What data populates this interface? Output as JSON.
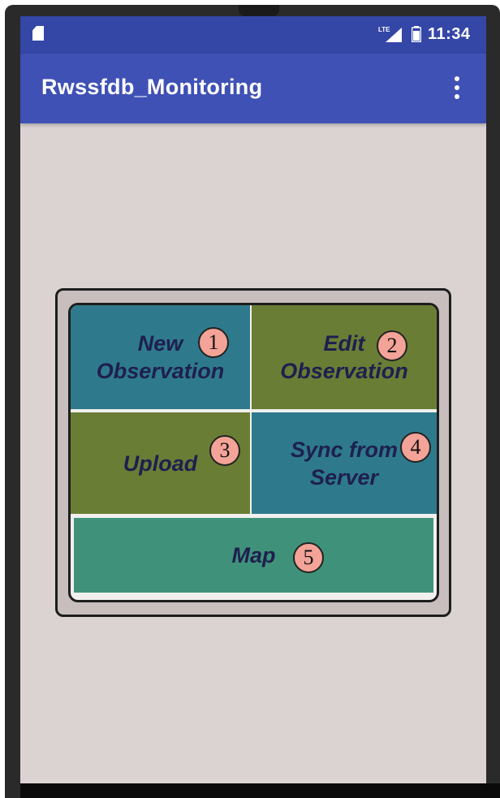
{
  "status_bar": {
    "time": "11:34",
    "icons": [
      "sd-card-icon",
      "lte-signal-icon",
      "battery-icon"
    ]
  },
  "app_bar": {
    "title": "Rwssfdb_Monitoring",
    "menu_icon": "overflow-menu-icon"
  },
  "tiles": {
    "new_observation": {
      "label": "New\nObservation",
      "badge": "1",
      "color": "#2e7a8c"
    },
    "edit_observation": {
      "label": "Edit\nObservation",
      "badge": "2",
      "color": "#6a7d35"
    },
    "upload": {
      "label": "Upload",
      "badge": "3",
      "color": "#6a7d35"
    },
    "sync_from_server": {
      "label": "Sync from\nServer",
      "badge": "4",
      "color": "#2e7a8c"
    },
    "map": {
      "label": "Map",
      "badge": "5",
      "color": "#3f9279"
    }
  },
  "colors": {
    "status_bar": "#3446a6",
    "app_bar": "#3f51b5",
    "screen_background": "#dbd3d2",
    "label_text": "#1f1f4f",
    "badge_fill": "#f3a397"
  }
}
